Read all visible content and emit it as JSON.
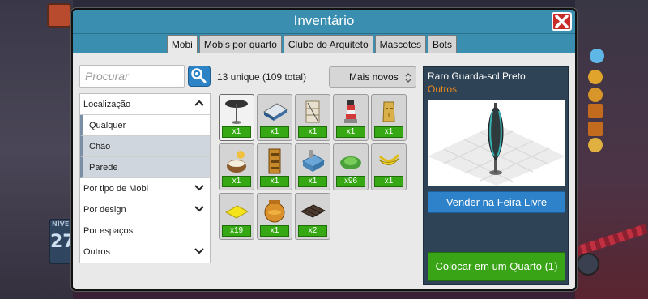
{
  "window": {
    "title": "Inventário"
  },
  "tabs": [
    {
      "label": "Mobi",
      "active": true
    },
    {
      "label": "Mobis por quarto"
    },
    {
      "label": "Clube do Arquiteto"
    },
    {
      "label": "Mascotes"
    },
    {
      "label": "Bots"
    }
  ],
  "search": {
    "placeholder": "Procurar"
  },
  "inventory": {
    "count_label": "13 unique (109 total)",
    "sort_label": "Mais novos"
  },
  "filters": {
    "location": {
      "label": "Localização",
      "options": [
        "Qualquer",
        "Chão",
        "Parede"
      ],
      "selected": "Qualquer"
    },
    "groups": [
      "Por tipo de Mobi",
      "Por design",
      "Por espaços",
      "Outros"
    ]
  },
  "items": [
    {
      "icon": "parasol-icon",
      "qty": "x1"
    },
    {
      "icon": "bed-icon",
      "qty": "x1"
    },
    {
      "icon": "shelf-icon",
      "qty": "x1"
    },
    {
      "icon": "lighthouse-icon",
      "qty": "x1"
    },
    {
      "icon": "statue-head-icon",
      "qty": "x1"
    },
    {
      "icon": "coconut-drink-icon",
      "qty": "x1"
    },
    {
      "icon": "tiki-totem-icon",
      "qty": "x1"
    },
    {
      "icon": "fish-tank-icon",
      "qty": "x1"
    },
    {
      "icon": "lettuce-icon",
      "qty": "x96"
    },
    {
      "icon": "banana-icon",
      "qty": "x1"
    },
    {
      "icon": "yellow-tile-icon",
      "qty": "x19"
    },
    {
      "icon": "honey-pot-icon",
      "qty": "x1"
    },
    {
      "icon": "dark-tile-icon",
      "qty": "x2"
    }
  ],
  "selected_item": {
    "name": "Raro Guarda-sol Preto",
    "category": "Outros",
    "sell_label": "Vender na Feira Livre",
    "place_label": "Colocar em um Quarto (1)"
  },
  "background": {
    "level_label": "NÍVEL",
    "level": "27"
  },
  "colors": {
    "title_bar": "#3a8fb0",
    "qty_badge": "#35a814",
    "category": "#f08a1d",
    "sell": "#2d82c9",
    "place": "#3aa417"
  }
}
